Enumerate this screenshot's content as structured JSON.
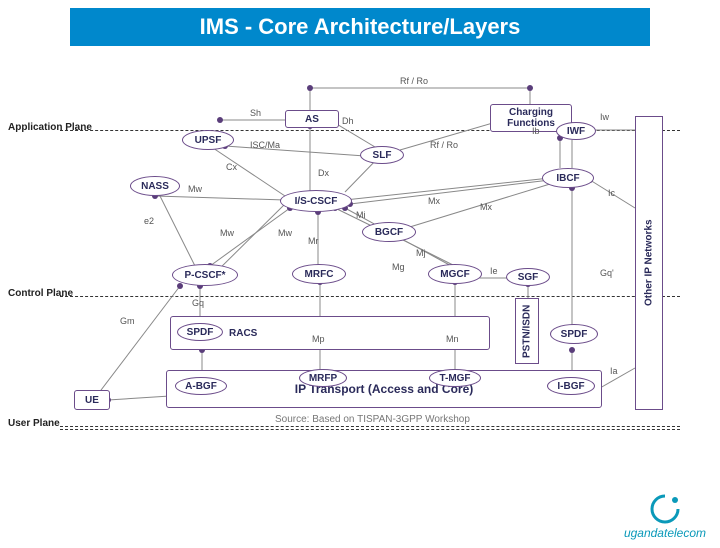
{
  "title": "IMS - Core Architecture/Layers",
  "source_note": "Source: Based on TISPAN-3GPP Workshop",
  "planes": {
    "application": "Application Plane",
    "control": "Control Plane",
    "user": "User Plane"
  },
  "nodes": {
    "charging": "Charging Functions",
    "as": "AS",
    "upsf": "UPSF",
    "slf": "SLF",
    "iwf": "IWF",
    "nass": "NASS",
    "iscscf": "I/S-CSCF",
    "ibcf": "IBCF",
    "pcscf": "P-CSCF*",
    "bgcf": "BGCF",
    "mrfc": "MRFC",
    "mgcf": "MGCF",
    "sgf": "SGF",
    "racs": "RACS",
    "spdf_l": "SPDF",
    "spdf_r": "SPDF",
    "abgf": "A-BGF",
    "mrfp": "MRFP",
    "tmgf": "T-MGF",
    "ibgf": "I-BGF",
    "ue": "UE",
    "ip_transport": "IP Transport (Access and Core)",
    "other_ip": "Other IP Networks",
    "pstn": "PSTN/ISDN"
  },
  "interfaces": {
    "rf_ro_top": "Rf / Ro",
    "sh": "Sh",
    "dh": "Dh",
    "isc_ma": "ISC/Ma",
    "rf_ro2": "Rf / Ro",
    "cx": "Cx",
    "dx": "Dx",
    "iw": "Iw",
    "ib": "Ib",
    "mw1": "Mw",
    "mw2": "Mw",
    "mw3": "Mw",
    "mi": "Mi",
    "mx1": "Mx",
    "mx2": "Mx",
    "ic": "Ic",
    "e2": "e2",
    "mr": "Mr",
    "mj": "Mj",
    "mg": "Mg",
    "ie": "Ie",
    "gq": "Gq",
    "gq2": "Gq'",
    "gm": "Gm",
    "mp": "Mp",
    "mn": "Mn",
    "ia": "Ia"
  },
  "brand": "ugandatelecom"
}
